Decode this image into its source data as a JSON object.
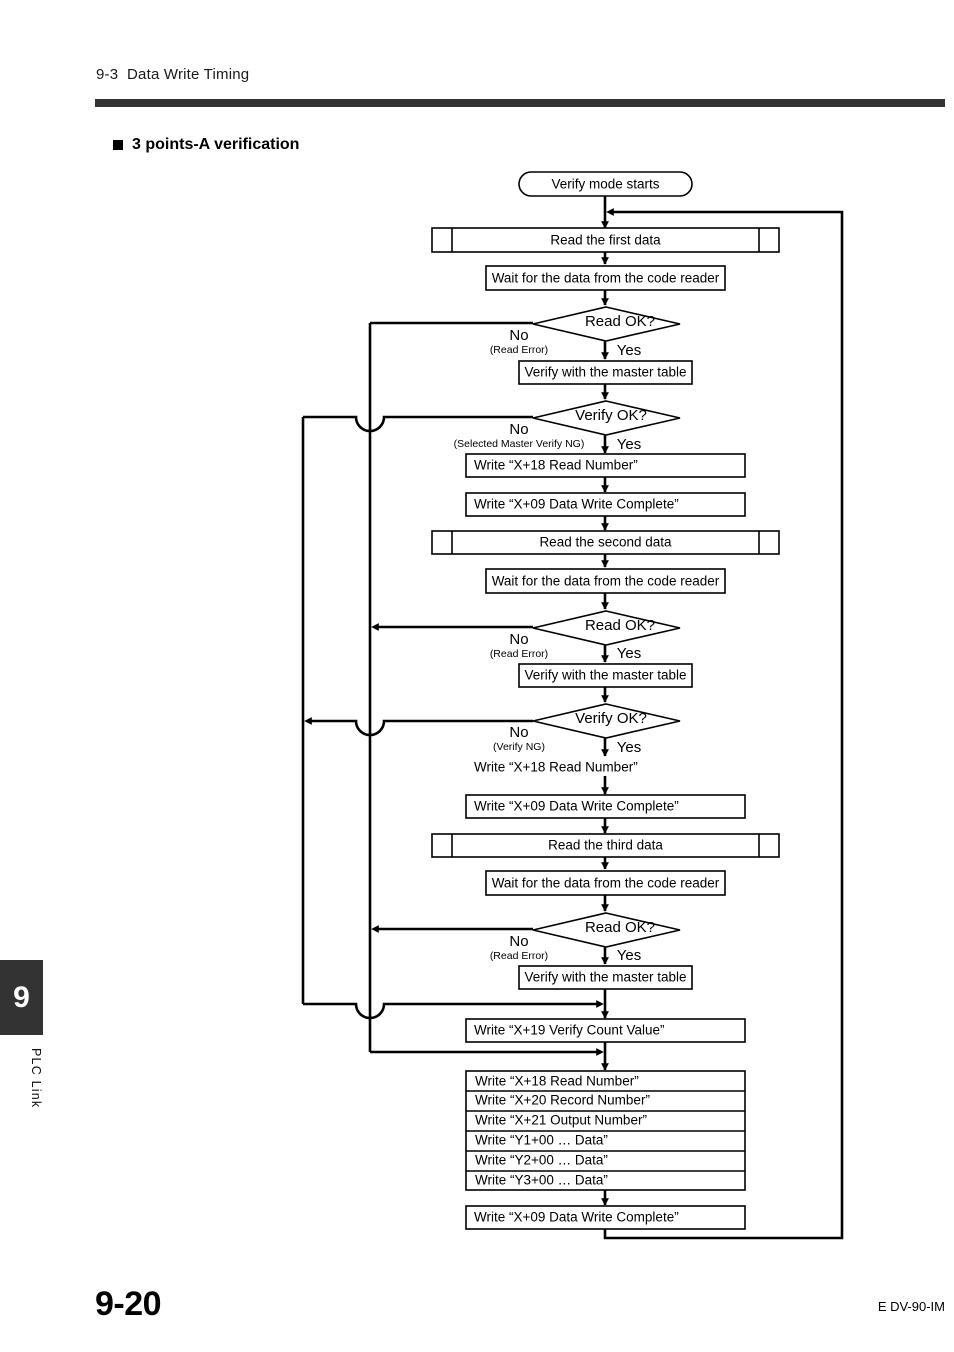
{
  "page": {
    "header_title": "9-3  Data Write Timing",
    "section_heading": "3 points-A verification",
    "chapter_number": "9",
    "chapter_side_label": "PLC Link",
    "footer_page_number": "9-20",
    "footer_doc_code": "E DV-90-IM"
  },
  "chart_data": {
    "type": "diagram",
    "title": "3 points-A verification",
    "nodes": [
      {
        "id": "start",
        "kind": "terminator",
        "label": "Verify mode starts"
      },
      {
        "id": "read1",
        "kind": "subroutine",
        "label": "Read the first data"
      },
      {
        "id": "wait1",
        "kind": "process",
        "label": "Wait for the data from the code reader"
      },
      {
        "id": "readok1",
        "kind": "decision",
        "label": "Read OK?"
      },
      {
        "id": "verify1",
        "kind": "process",
        "label": "Verify with the master table"
      },
      {
        "id": "verifyok1",
        "kind": "decision",
        "label": "Verify OK?"
      },
      {
        "id": "w18a",
        "kind": "process",
        "label": "Write “X+18 Read Number”"
      },
      {
        "id": "w09a",
        "kind": "process",
        "label": "Write “X+09 Data Write Complete”"
      },
      {
        "id": "read2",
        "kind": "subroutine",
        "label": "Read the second data"
      },
      {
        "id": "wait2",
        "kind": "process",
        "label": "Wait for the data from the code reader"
      },
      {
        "id": "readok2",
        "kind": "decision",
        "label": "Read OK?"
      },
      {
        "id": "verify2",
        "kind": "process",
        "label": "Verify with the master table"
      },
      {
        "id": "verifyok2",
        "kind": "decision",
        "label": "Verify OK?"
      },
      {
        "id": "w18b",
        "kind": "borderless",
        "label": "Write “X+18 Read Number”"
      },
      {
        "id": "w09b",
        "kind": "process",
        "label": "Write “X+09 Data Write Complete”"
      },
      {
        "id": "read3",
        "kind": "subroutine",
        "label": "Read the third data"
      },
      {
        "id": "wait3",
        "kind": "process",
        "label": "Wait for the data from the code reader"
      },
      {
        "id": "readok3",
        "kind": "decision",
        "label": "Read OK?"
      },
      {
        "id": "verify3",
        "kind": "process",
        "label": "Verify with the master table"
      },
      {
        "id": "w19",
        "kind": "process",
        "label": "Write “X+19 Verify Count Value”"
      },
      {
        "id": "stack1",
        "kind": "process",
        "label": "Write “X+18 Read Number”"
      },
      {
        "id": "stack2",
        "kind": "process",
        "label": "Write “X+20 Record Number”"
      },
      {
        "id": "stack3",
        "kind": "process",
        "label": "Write “X+21 Output Number”"
      },
      {
        "id": "stack4",
        "kind": "process",
        "label": "Write “Y1+00 … Data”"
      },
      {
        "id": "stack5",
        "kind": "process",
        "label": "Write “Y2+00 … Data”"
      },
      {
        "id": "stack6",
        "kind": "process",
        "label": "Write “Y3+00 … Data”"
      },
      {
        "id": "w09c",
        "kind": "process",
        "label": "Write “X+09 Data Write Complete”"
      }
    ],
    "branch_labels": {
      "yes": "Yes",
      "no": "No",
      "read_error": "(Read Error)",
      "selected_master_verify_ng": "(Selected Master Verify NG)",
      "verify_ng": "(Verify NG)"
    },
    "edges": [
      {
        "from": "start",
        "to": "read1",
        "label": ""
      },
      {
        "from": "read1",
        "to": "wait1",
        "label": ""
      },
      {
        "from": "wait1",
        "to": "readok1",
        "label": ""
      },
      {
        "from": "readok1",
        "to": "verify1",
        "label": "Yes"
      },
      {
        "from": "readok1",
        "to": "w19",
        "label": "No (Read Error)"
      },
      {
        "from": "verify1",
        "to": "verifyok1",
        "label": ""
      },
      {
        "from": "verifyok1",
        "to": "w18a",
        "label": "Yes"
      },
      {
        "from": "verifyok1",
        "to": "stack1",
        "label": "No (Selected Master Verify NG)"
      },
      {
        "from": "w18a",
        "to": "w09a",
        "label": ""
      },
      {
        "from": "w09a",
        "to": "read2",
        "label": ""
      },
      {
        "from": "read2",
        "to": "wait2",
        "label": ""
      },
      {
        "from": "wait2",
        "to": "readok2",
        "label": ""
      },
      {
        "from": "readok2",
        "to": "verify2",
        "label": "Yes"
      },
      {
        "from": "readok2",
        "to": "w19",
        "label": "No (Read Error)"
      },
      {
        "from": "verify2",
        "to": "verifyok2",
        "label": ""
      },
      {
        "from": "verifyok2",
        "to": "w18b",
        "label": "Yes"
      },
      {
        "from": "verifyok2",
        "to": "stack1",
        "label": "No (Verify NG)"
      },
      {
        "from": "w18b",
        "to": "w09b",
        "label": ""
      },
      {
        "from": "w09b",
        "to": "read3",
        "label": ""
      },
      {
        "from": "read3",
        "to": "wait3",
        "label": ""
      },
      {
        "from": "wait3",
        "to": "readok3",
        "label": ""
      },
      {
        "from": "readok3",
        "to": "verify3",
        "label": "Yes"
      },
      {
        "from": "readok3",
        "to": "w19",
        "label": "No (Read Error)"
      },
      {
        "from": "verify3",
        "to": "w19",
        "label": ""
      },
      {
        "from": "w19",
        "to": "stack1",
        "label": ""
      },
      {
        "from": "stack6",
        "to": "w09c",
        "label": ""
      },
      {
        "from": "w09c",
        "to": "read1",
        "label": "loop back to top"
      }
    ]
  }
}
